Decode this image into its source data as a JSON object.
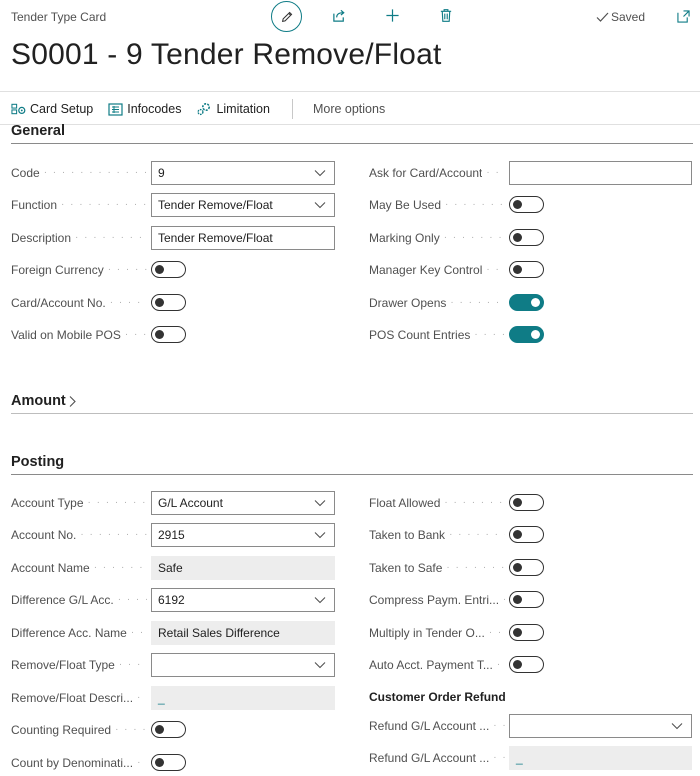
{
  "header": {
    "card_type": "Tender Type Card",
    "saved_label": "Saved",
    "title": "S0001 - 9 Tender Remove/Float"
  },
  "actions": {
    "card_setup": "Card Setup",
    "infocodes": "Infocodes",
    "limitation": "Limitation",
    "more_options": "More options"
  },
  "general": {
    "title": "General",
    "code": {
      "label": "Code",
      "value": "9"
    },
    "function": {
      "label": "Function",
      "value": "Tender Remove/Float"
    },
    "description": {
      "label": "Description",
      "value": "Tender Remove/Float"
    },
    "foreign_currency": {
      "label": "Foreign Currency",
      "on": false
    },
    "card_account_no": {
      "label": "Card/Account No.",
      "on": false
    },
    "valid_mobile_pos": {
      "label": "Valid on Mobile POS",
      "on": false
    },
    "ask_card_account": {
      "label": "Ask for Card/Account",
      "value": ""
    },
    "may_be_used": {
      "label": "May Be Used",
      "on": false
    },
    "marking_only": {
      "label": "Marking Only",
      "on": false
    },
    "manager_key_control": {
      "label": "Manager Key Control",
      "on": false
    },
    "drawer_opens": {
      "label": "Drawer Opens",
      "on": true
    },
    "pos_count_entries": {
      "label": "POS Count Entries",
      "on": true
    }
  },
  "amount": {
    "title": "Amount"
  },
  "posting": {
    "title": "Posting",
    "account_type": {
      "label": "Account Type",
      "value": "G/L Account"
    },
    "account_no": {
      "label": "Account No.",
      "value": "2915"
    },
    "account_name": {
      "label": "Account Name",
      "value": "Safe"
    },
    "difference_gl_acc": {
      "label": "Difference G/L Acc.",
      "value": "6192"
    },
    "difference_acc_name": {
      "label": "Difference Acc. Name",
      "value": "Retail Sales Difference"
    },
    "remove_float_type": {
      "label": "Remove/Float Type",
      "value": ""
    },
    "remove_float_descr": {
      "label": "Remove/Float Descri...",
      "value": "_"
    },
    "counting_required": {
      "label": "Counting Required",
      "on": false
    },
    "count_by_denomination": {
      "label": "Count by Denominati...",
      "on": false
    },
    "float_allowed": {
      "label": "Float Allowed",
      "on": false
    },
    "taken_to_bank": {
      "label": "Taken to Bank",
      "on": false
    },
    "taken_to_safe": {
      "label": "Taken to Safe",
      "on": false
    },
    "compress_paym": {
      "label": "Compress Paym. Entri...",
      "on": false
    },
    "multiply_in_tender": {
      "label": "Multiply in Tender O...",
      "on": false
    },
    "auto_acct_payment": {
      "label": "Auto Acct. Payment T...",
      "on": false
    },
    "customer_order_refund": "Customer Order Refund",
    "refund_gl_account_1": {
      "label": "Refund G/L Account ...",
      "value": ""
    },
    "refund_gl_account_2": {
      "label": "Refund G/L Account ...",
      "value": "_"
    }
  },
  "colors": {
    "accent": "#0f7c86",
    "text": "#212121",
    "label": "#505050"
  }
}
